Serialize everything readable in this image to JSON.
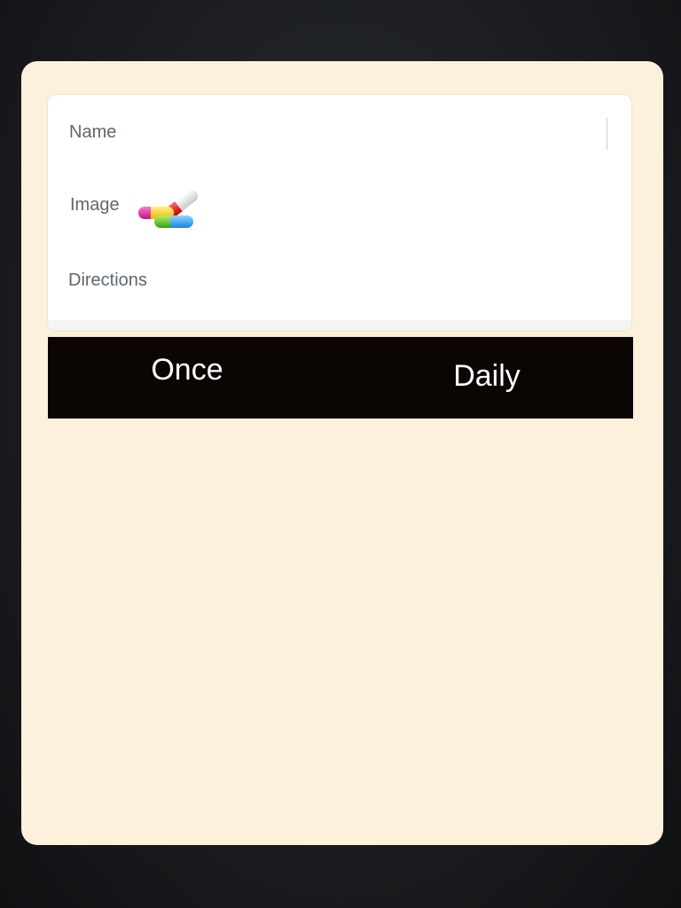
{
  "form": {
    "name_label": "Name",
    "image_label": "Image",
    "directions_label": "Directions"
  },
  "frequency": {
    "options": [
      "Once",
      "Daily"
    ]
  },
  "icons": {
    "image": "pills-icon"
  },
  "colors": {
    "card_background": "#fdf1dc",
    "segment_background": "#0b0603",
    "label_text": "#5e676f"
  }
}
